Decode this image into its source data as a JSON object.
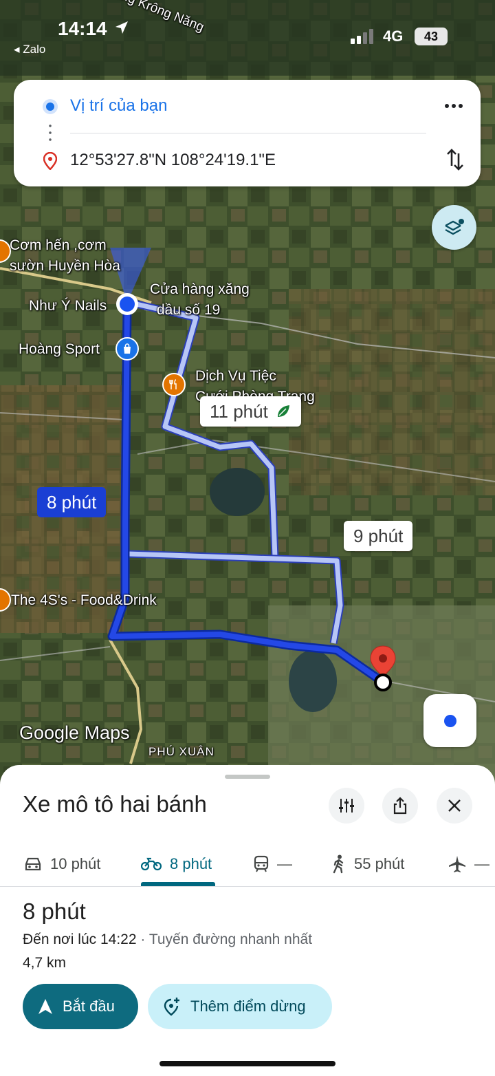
{
  "status_bar": {
    "time": "14:14",
    "back_app": "◂ Zalo",
    "network": "4G",
    "battery": "43"
  },
  "directions": {
    "origin": "Vị trí của bạn",
    "destination": "12°53'27.8\"N 108°24'19.1\"E"
  },
  "map": {
    "labels": {
      "river": "Sông Krông Năng",
      "poi_com_hen_1": "Cơm hến ,cơm",
      "poi_com_hen_2": "sườn Huyền Hòa",
      "poi_xang_1": "Cửa hàng xăng",
      "poi_xang_2": "dầu số 19",
      "poi_nails": "Như Ý Nails",
      "poi_sport": "Hoàng Sport",
      "poi_tiec_1": "Dịch Vụ Tiệc",
      "poi_tiec_2": "Cưới Phòng Trang",
      "poi_4s": "The 4S's - Food&Drink",
      "area_phu_xuan": "PHÚ XUÂN",
      "watermark": "Google Maps"
    },
    "route_times": {
      "main": "8 phút",
      "alt1": "11 phút",
      "alt2": "9 phút"
    }
  },
  "sheet": {
    "title": "Xe mô tô hai bánh",
    "modes": [
      {
        "icon": "car-icon",
        "label": "10 phút"
      },
      {
        "icon": "motorbike-icon",
        "label": "8 phút"
      },
      {
        "icon": "transit-icon",
        "label": "—"
      },
      {
        "icon": "walk-icon",
        "label": "55 phút"
      },
      {
        "icon": "flight-icon",
        "label": "—"
      }
    ],
    "duration": "8 phút",
    "arrive_text": "Đến nơi lúc 14:22",
    "route_note": " · Tuyến đường nhanh nhất",
    "distance": "4,7 km",
    "start_label": "Bắt đầu",
    "add_stop_label": "Thêm điểm dừng"
  },
  "colors": {
    "route_main": "#1a3fd4",
    "route_alt": "#aebff5",
    "accent": "#0e6b7f",
    "pin": "#d93025"
  }
}
